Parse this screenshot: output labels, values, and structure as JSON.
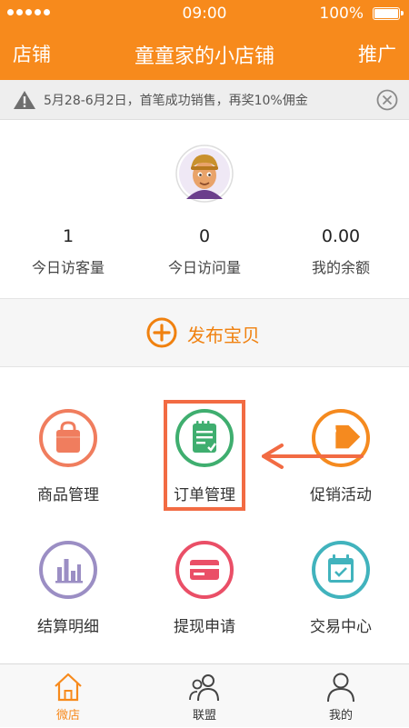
{
  "status_bar": {
    "time": "09:00",
    "battery": "100%"
  },
  "nav": {
    "left": "店铺",
    "title": "童童家的小店铺",
    "right": "推广"
  },
  "notice": {
    "text": "5月28-6月2日，首笔成功销售，再奖10%佣金",
    "icon": "warning-icon"
  },
  "stats": [
    {
      "value": "1",
      "label": "今日访客量"
    },
    {
      "value": "0",
      "label": "今日访问量"
    },
    {
      "value": "0.00",
      "label": "我的余额"
    }
  ],
  "publish": {
    "label": "发布宝贝",
    "icon": "plus-circle-icon"
  },
  "grid": [
    {
      "label": "商品管理",
      "icon": "shopping-bag-icon",
      "color": "#f07d5e"
    },
    {
      "label": "订单管理",
      "icon": "order-notepad-icon",
      "color": "#3fae6f"
    },
    {
      "label": "促销活动",
      "icon": "price-tag-icon",
      "color": "#f58a1f"
    },
    {
      "label": "结算明细",
      "icon": "bar-chart-icon",
      "color": "#9b8ec4"
    },
    {
      "label": "提现申请",
      "icon": "credit-card-icon",
      "color": "#ea4f67"
    },
    {
      "label": "交易中心",
      "icon": "calendar-check-icon",
      "color": "#41b3bd"
    }
  ],
  "tabs": [
    {
      "label": "微店",
      "icon": "home-icon",
      "active": true
    },
    {
      "label": "联盟",
      "icon": "group-icon",
      "active": false
    },
    {
      "label": "我的",
      "icon": "user-icon",
      "active": false
    }
  ],
  "colors": {
    "primary": "#f78a1c",
    "highlight": "#f26b43"
  }
}
